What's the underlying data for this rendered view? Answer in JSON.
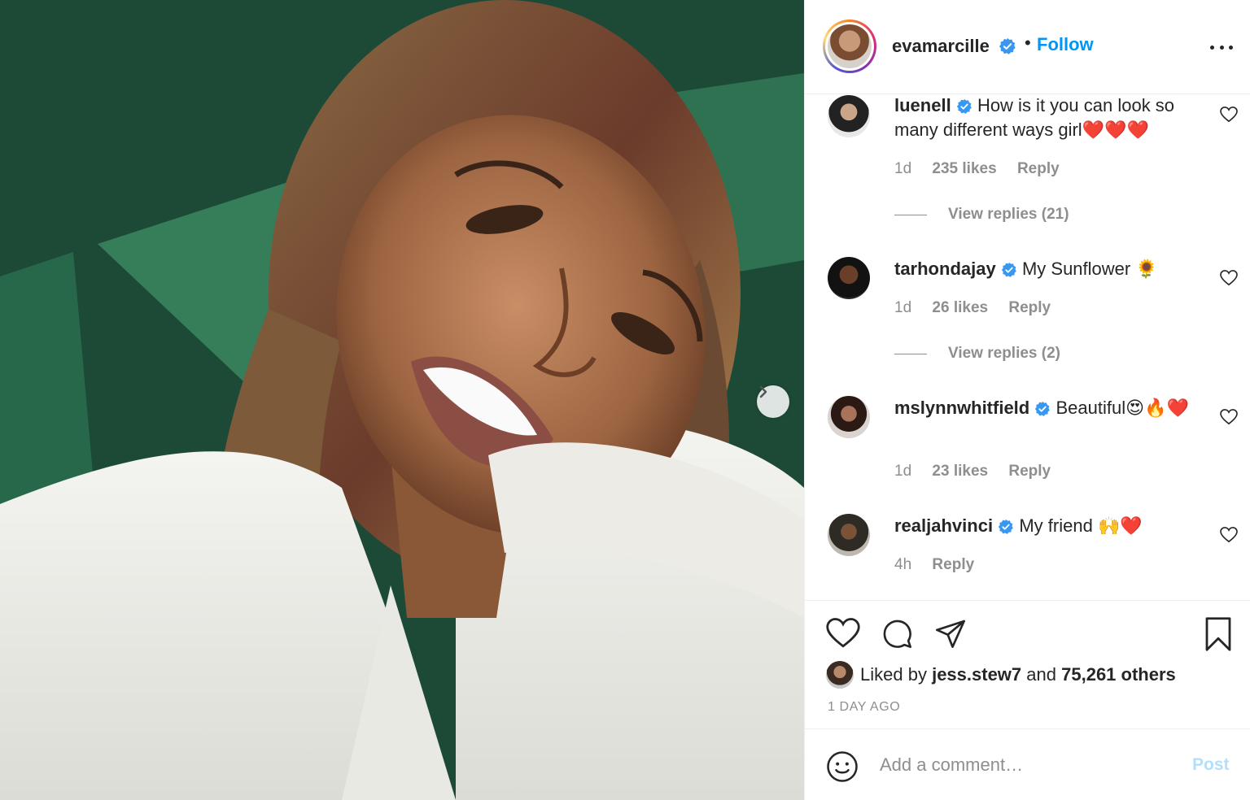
{
  "post": {
    "username": "evamarcille",
    "follow_label": "Follow",
    "separator": "•"
  },
  "comments": [
    {
      "username": "luenell",
      "text": "How is it you can look so many different ways girl",
      "emoji": "❤️❤️❤️",
      "age": "1d",
      "likes": "235 likes",
      "reply": "Reply",
      "view_replies": "View replies (21)"
    },
    {
      "username": "tarhondajay",
      "text": "My Sunflower",
      "emoji": "🌻",
      "age": "1d",
      "likes": "26 likes",
      "reply": "Reply",
      "view_replies": "View replies (2)"
    },
    {
      "username": "mslynnwhitfield",
      "text": "Beautiful",
      "emoji": "😍🔥❤️",
      "age": "1d",
      "likes": "23 likes",
      "reply": "Reply"
    },
    {
      "username": "realjahvinci",
      "text": "My friend",
      "emoji": "🙌❤️",
      "age": "4h",
      "reply": "Reply"
    }
  ],
  "actions": {
    "liked_prefix": "Liked by",
    "liked_user": "jess.stew7",
    "liked_and": "and",
    "liked_others": "75,261 others",
    "time_ago": "1 DAY AGO"
  },
  "add_comment": {
    "placeholder": "Add a comment…",
    "post_label": "Post"
  },
  "icons": {
    "verified": "verified-badge-icon",
    "more": "more-options-icon",
    "next": "chevron-right-icon",
    "heart": "heart-icon",
    "comment": "comment-icon",
    "share": "share-icon",
    "save": "bookmark-icon",
    "smiley": "smiley-icon"
  },
  "colors": {
    "accent": "#0095f6",
    "verified": "#3897f0",
    "secondary_text": "#8e8e8e",
    "post_disabled": "#b2dffc"
  }
}
